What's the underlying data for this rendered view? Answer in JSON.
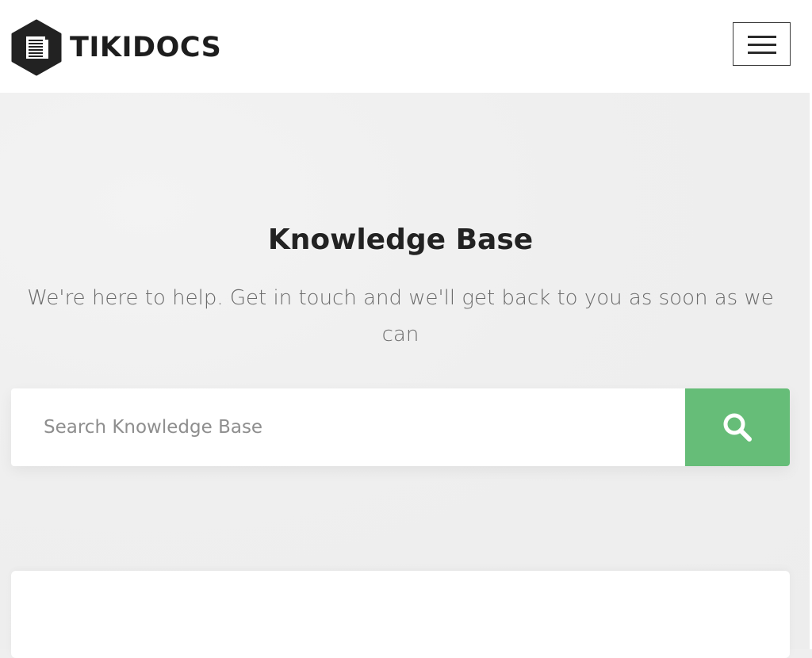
{
  "brand": {
    "name": "TIKIDOCS",
    "logo_icon": "document-hexagon-icon"
  },
  "header": {
    "menu_icon": "hamburger-menu-icon"
  },
  "hero": {
    "title": "Knowledge Base",
    "subtitle": "We're here to help. Get in touch and we'll get back to you as soon as we can"
  },
  "search": {
    "placeholder": "Search Knowledge Base",
    "value": "",
    "button_icon": "search-icon",
    "button_color": "#66bd78"
  },
  "colors": {
    "page_background": "#efefef",
    "header_background": "#ffffff",
    "accent": "#66bd78",
    "logo_dark": "#222222"
  }
}
